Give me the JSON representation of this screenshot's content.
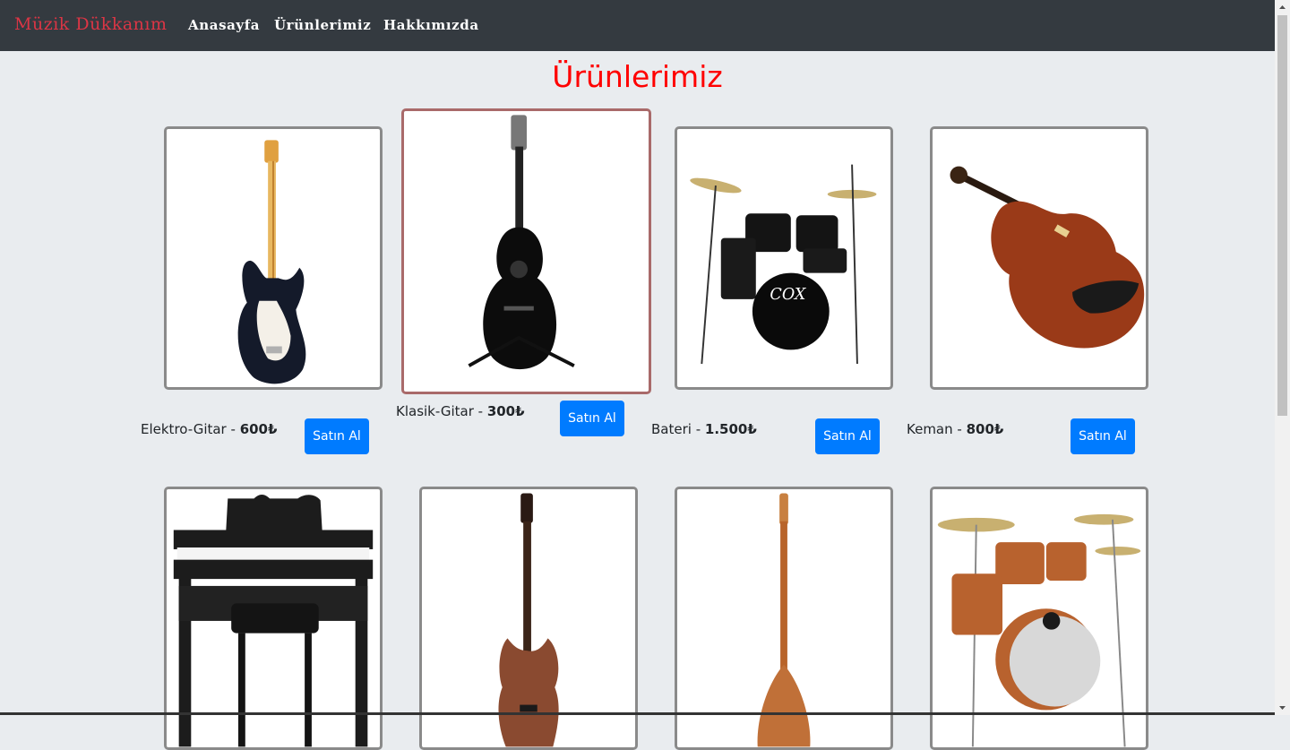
{
  "navbar": {
    "brand": "Müzik Dükkanım",
    "links": [
      "Anasayfa",
      "Ürünlerimiz",
      "Hakkımızda"
    ]
  },
  "page": {
    "title": "Ürünlerimiz"
  },
  "products": [
    {
      "name": "Elektro-Gitar",
      "separator": " - ",
      "price": "600₺",
      "button": "Satın Al"
    },
    {
      "name": "Klasik-Gitar",
      "separator": " - ",
      "price": "300₺",
      "button": "Satın Al"
    },
    {
      "name": "Bateri",
      "separator": " - ",
      "price": "1.500₺",
      "button": "Satın Al"
    },
    {
      "name": "Keman",
      "separator": " - ",
      "price": "800₺",
      "button": "Satın Al"
    }
  ],
  "colors": {
    "navbar_bg": "#343a40",
    "brand": "#dc3545",
    "title": "#ff0000",
    "button": "#007bff",
    "page_bg": "#e9ecef"
  }
}
